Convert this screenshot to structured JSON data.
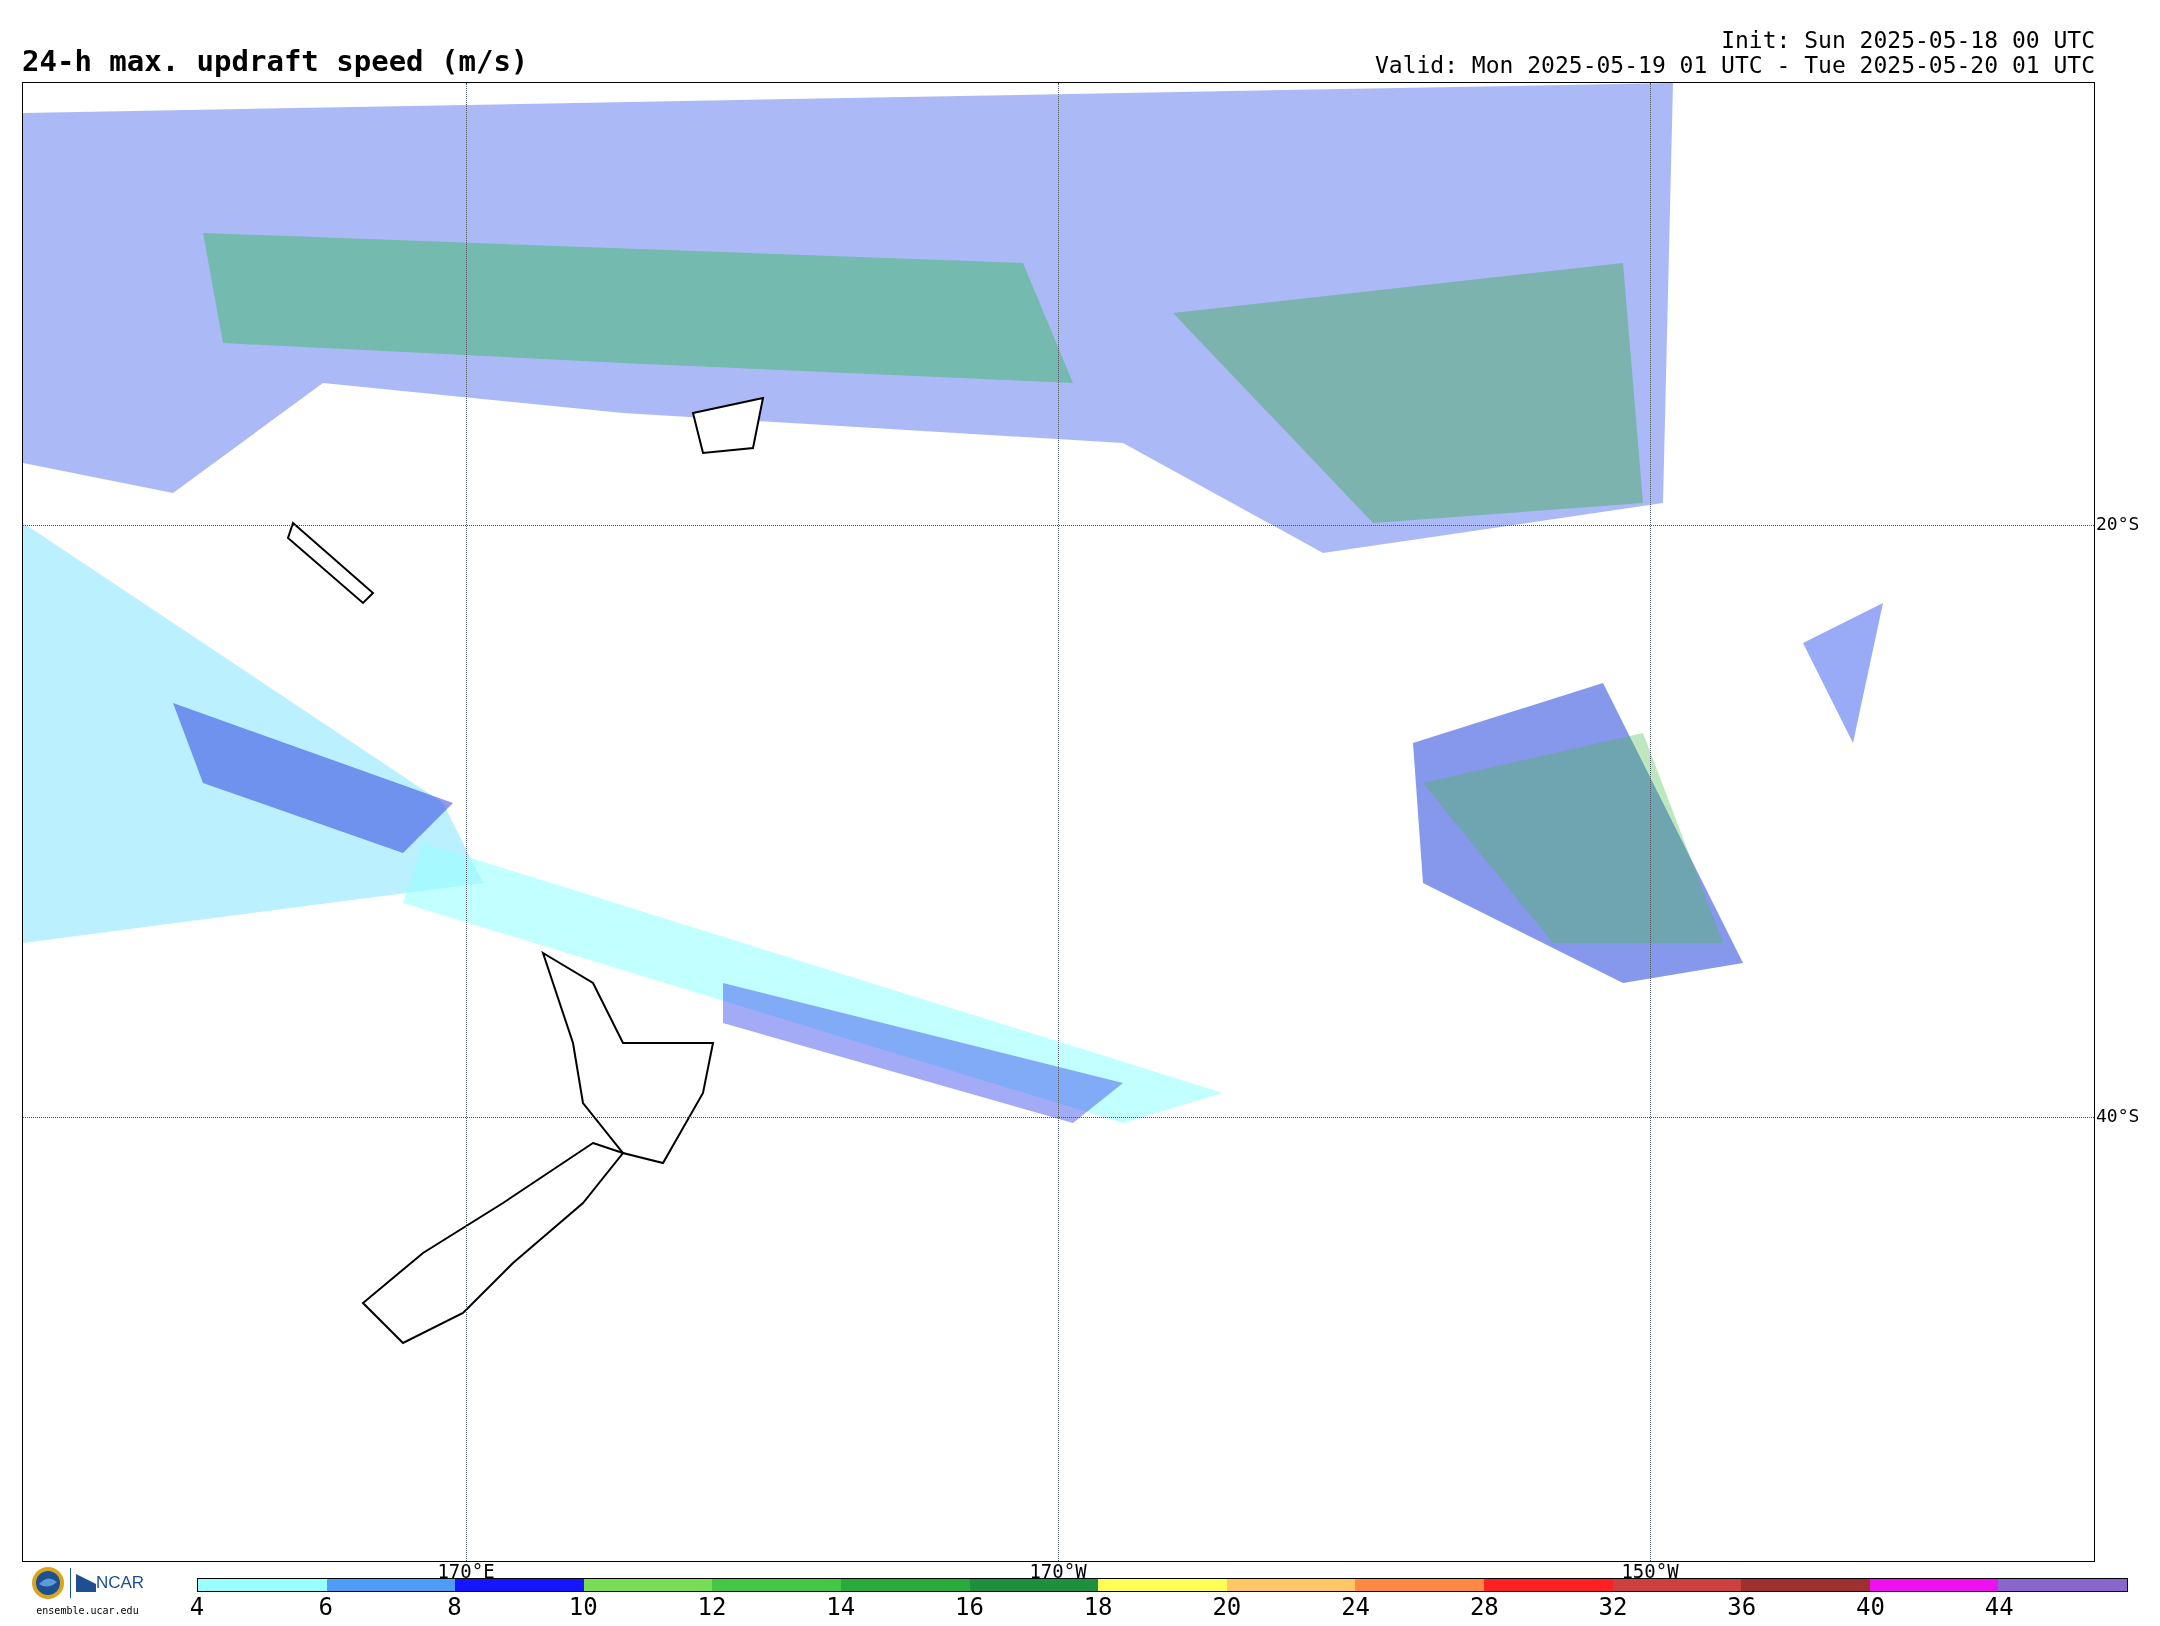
{
  "title": "24-h max. updraft speed (m/s)",
  "init": "Init: Sun 2025-05-18 00 UTC",
  "valid": "Valid: Mon 2025-05-19 01 UTC - Tue 2025-05-20 01 UTC",
  "map": {
    "lat_labels": [
      "20°S",
      "40°S"
    ],
    "lon_labels": [
      "170°E",
      "170°W",
      "150°W"
    ]
  },
  "logo": {
    "text": "NCAR",
    "site": "ensemble.ucar.edu"
  },
  "colorbar": {
    "segments": [
      {
        "color": "#99ffff"
      },
      {
        "color": "#4f9cf7"
      },
      {
        "color": "#1515ff"
      },
      {
        "color": "#77dd55"
      },
      {
        "color": "#44c744"
      },
      {
        "color": "#2aaa3a"
      },
      {
        "color": "#1d8f3e"
      },
      {
        "color": "#ffff55"
      },
      {
        "color": "#ffc766"
      },
      {
        "color": "#ff8844"
      },
      {
        "color": "#ff2020"
      },
      {
        "color": "#cc4040"
      },
      {
        "color": "#a03030"
      },
      {
        "color": "#ee10ee"
      },
      {
        "color": "#8866cc"
      }
    ],
    "tick_labels": [
      "4",
      "6",
      "8",
      "10",
      "12",
      "14",
      "16",
      "18",
      "20",
      "24",
      "28",
      "32",
      "36",
      "40",
      "44"
    ]
  }
}
